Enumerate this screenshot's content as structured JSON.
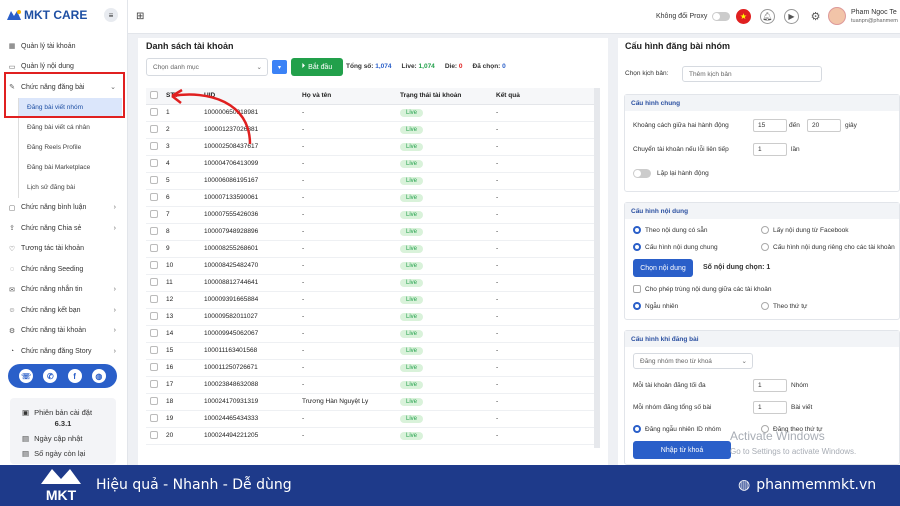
{
  "brand": {
    "logo_text": "MKT CARE"
  },
  "sidebar": {
    "items": [
      {
        "label": "Quản lý tài khoản",
        "icon": "grid-icon"
      },
      {
        "label": "Quản lý nội dung",
        "icon": "folder-icon"
      },
      {
        "label": "Chức năng đăng bài",
        "icon": "edit-icon",
        "expanded": true
      },
      {
        "label": "Chức năng bình luận",
        "icon": "comment-icon"
      },
      {
        "label": "Chức năng Chia sẻ",
        "icon": "share-icon"
      },
      {
        "label": "Tương tác tài khoản",
        "icon": "interact-icon"
      },
      {
        "label": "Chức năng Seeding",
        "icon": "seed-icon"
      },
      {
        "label": "Chức năng nhắn tin",
        "icon": "message-icon"
      },
      {
        "label": "Chức năng kết bạn",
        "icon": "friend-icon"
      },
      {
        "label": "Chức năng tài khoản",
        "icon": "account-icon"
      },
      {
        "label": "Chức năng đăng Story",
        "icon": "story-icon"
      }
    ],
    "subitems": [
      "Đăng bài viết nhóm",
      "Đăng bài viết cá nhân",
      "Đăng Reels Profile",
      "Đăng bài Marketplace",
      "Lịch sử đăng bài"
    ],
    "version_label": "Phiên bản cài đặt",
    "version_value": "6.3.1",
    "update_label": "Ngày cập nhật",
    "days_label": "Số ngày còn lại"
  },
  "topbar": {
    "proxy_label": "Không đổi Proxy",
    "user_name": "Pham Ngoc Te",
    "user_email": "tuanpn@phanmem"
  },
  "list": {
    "title": "Danh sách tài khoản",
    "category_placeholder": "Chọn danh mục",
    "start_label": "Bắt đầu",
    "total_label": "Tổng số:",
    "total": "1,074",
    "live_label": "Live:",
    "live": "1,074",
    "die_label": "Die:",
    "die": "0",
    "selected_label": "Đã chọn:",
    "selected": "0",
    "columns": [
      "STT",
      "UID",
      "Họ và tên",
      "Trạng thái tài khoản",
      "Kết quả"
    ],
    "rows": [
      {
        "stt": "1",
        "uid": "100000650918981",
        "name": "-",
        "status": "Live",
        "result": "-"
      },
      {
        "stt": "2",
        "uid": "100001237026881",
        "name": "-",
        "status": "Live",
        "result": "-"
      },
      {
        "stt": "3",
        "uid": "100002508437617",
        "name": "-",
        "status": "Live",
        "result": "-"
      },
      {
        "stt": "4",
        "uid": "100004706413099",
        "name": "-",
        "status": "Live",
        "result": "-"
      },
      {
        "stt": "5",
        "uid": "100006086195167",
        "name": "-",
        "status": "Live",
        "result": "-"
      },
      {
        "stt": "6",
        "uid": "100007133590061",
        "name": "-",
        "status": "Live",
        "result": "-"
      },
      {
        "stt": "7",
        "uid": "100007555426036",
        "name": "-",
        "status": "Live",
        "result": "-"
      },
      {
        "stt": "8",
        "uid": "100007948928896",
        "name": "-",
        "status": "Live",
        "result": "-"
      },
      {
        "stt": "9",
        "uid": "100008255268601",
        "name": "-",
        "status": "Live",
        "result": "-"
      },
      {
        "stt": "10",
        "uid": "100008425482470",
        "name": "-",
        "status": "Live",
        "result": "-"
      },
      {
        "stt": "11",
        "uid": "100008812744641",
        "name": "-",
        "status": "Live",
        "result": "-"
      },
      {
        "stt": "12",
        "uid": "100009391665884",
        "name": "-",
        "status": "Live",
        "result": "-"
      },
      {
        "stt": "13",
        "uid": "100009582011027",
        "name": "-",
        "status": "Live",
        "result": "-"
      },
      {
        "stt": "14",
        "uid": "100009945062067",
        "name": "-",
        "status": "Live",
        "result": "-"
      },
      {
        "stt": "15",
        "uid": "100011163401568",
        "name": "-",
        "status": "Live",
        "result": "-"
      },
      {
        "stt": "16",
        "uid": "100011250726671",
        "name": "-",
        "status": "Live",
        "result": "-"
      },
      {
        "stt": "17",
        "uid": "100023848632088",
        "name": "-",
        "status": "Live",
        "result": "-"
      },
      {
        "stt": "18",
        "uid": "100024170931319",
        "name": "Trương Hàn Nguyệt Ly",
        "status": "Live",
        "result": "-"
      },
      {
        "stt": "19",
        "uid": "100024465434333",
        "name": "-",
        "status": "Live",
        "result": "-"
      },
      {
        "stt": "20",
        "uid": "100024494221205",
        "name": "-",
        "status": "Live",
        "result": "-"
      }
    ]
  },
  "config": {
    "title": "Cấu hình đăng bài nhóm",
    "scenario_label": "Chọn kịch bản:",
    "scenario_placeholder": "Thêm kịch bản",
    "general": {
      "title": "Cấu hình chung",
      "interval_label": "Khoảng cách giữa hai hành động",
      "from": "15",
      "to_label": "đến",
      "to": "20",
      "unit": "giây",
      "switch_label": "Chuyển tài khoản nếu lỗi liên tiếp",
      "switch_value": "1",
      "switch_unit": "lần",
      "repeat_label": "Lặp lại hành động"
    },
    "content": {
      "title": "Cấu hình nội dung",
      "opt1": "Theo nội dung có sẵn",
      "opt2": "Lấy nội dung từ Facebook",
      "opt3": "Cấu hình nội dung chung",
      "opt4": "Cấu hình nội dung riêng cho các tài khoản",
      "choose_btn": "Chọn nội dung",
      "count_label": "Số nội dung chọn: 1",
      "dup_label": "Cho phép trùng nội dung giữa các tài khoản",
      "random_label": "Ngẫu nhiên",
      "order_label": "Theo thứ tự"
    },
    "posting": {
      "title": "Cấu hình khi đăng bài",
      "mode": "Đăng nhóm theo từ khoá",
      "per_acc_label": "Mỗi tài khoản đăng tối đa",
      "per_acc_value": "1",
      "per_acc_unit": "Nhóm",
      "per_group_label": "Mỗi nhóm đăng tổng số bài",
      "per_group_value": "1",
      "per_group_unit": "Bài viết",
      "random_id_label": "Đăng ngẫu nhiên ID nhóm",
      "order_label": "Đăng theo thứ tự",
      "import_btn": "Nhập từ khoá"
    }
  },
  "watermark": {
    "line1": "Activate Windows",
    "line2": "Go to Settings to activate Windows."
  },
  "footer": {
    "logo": "MKT",
    "slogan": "Hiệu quả - Nhanh - Dễ dùng",
    "website": "phanmemmkt.vn"
  },
  "colors": {
    "primary": "#2a5fc9",
    "green": "#22a04b",
    "red": "#e02020",
    "footer": "#1e3a8a"
  }
}
